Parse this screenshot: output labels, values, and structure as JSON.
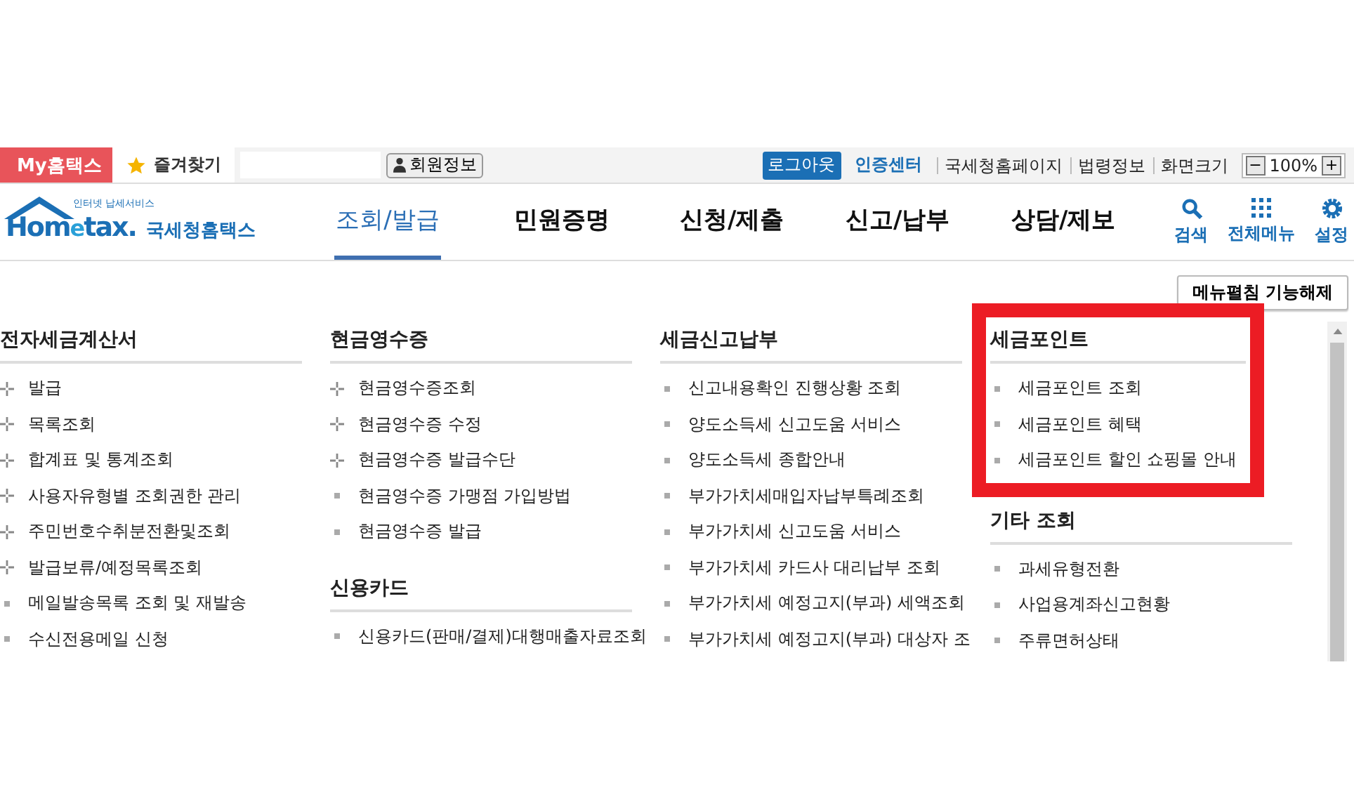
{
  "top_bar": {
    "my_hometax": "My홈택스",
    "favorites": "즐겨찾기",
    "member_info": "회원정보",
    "logout": "로그아웃",
    "cert_center": "인증센터",
    "links": [
      "국세청홈페이지",
      "법령정보"
    ],
    "screen_size": "화면크기",
    "zoom_minus": "−",
    "zoom_value": "100%",
    "zoom_plus": "+"
  },
  "header": {
    "logo": {
      "tagline": "인터넷 납세서비스",
      "name_start": "Hom",
      "name_e": "e",
      "name_end": "tax.",
      "korean": "국세청홈택스"
    },
    "tabs": [
      {
        "label": "조회/발급",
        "selected": true
      },
      {
        "label": "민원증명",
        "selected": false
      },
      {
        "label": "신청/제출",
        "selected": false
      },
      {
        "label": "신고/납부",
        "selected": false
      },
      {
        "label": "상담/제보",
        "selected": false
      }
    ],
    "tools": [
      {
        "kind": "search",
        "label": "검색"
      },
      {
        "kind": "grid",
        "label": "전체메뉴"
      },
      {
        "kind": "gear",
        "label": "설정"
      }
    ]
  },
  "menu_toggle": "메뉴펼침 기능해제",
  "columns": [
    {
      "sections": [
        {
          "title": "전자세금계산서",
          "highlighted": false,
          "items": [
            {
              "label": "발급",
              "kind": "cross"
            },
            {
              "label": "목록조회",
              "kind": "cross"
            },
            {
              "label": "합계표 및 통계조회",
              "kind": "cross"
            },
            {
              "label": "사용자유형별 조회권한 관리",
              "kind": "cross"
            },
            {
              "label": "주민번호수취분전환및조회",
              "kind": "cross"
            },
            {
              "label": "발급보류/예정목록조회",
              "kind": "cross"
            },
            {
              "label": "메일발송목록 조회 및 재발송",
              "kind": "square"
            },
            {
              "label": "수신전용메일 신청",
              "kind": "square"
            }
          ]
        }
      ]
    },
    {
      "sections": [
        {
          "title": "현금영수증",
          "highlighted": false,
          "items": [
            {
              "label": "현금영수증조회",
              "kind": "cross"
            },
            {
              "label": "현금영수증 수정",
              "kind": "cross"
            },
            {
              "label": "현금영수증 발급수단",
              "kind": "cross"
            },
            {
              "label": "현금영수증 가맹점 가입방법",
              "kind": "square"
            },
            {
              "label": "현금영수증 발급",
              "kind": "square"
            }
          ]
        },
        {
          "title": "신용카드",
          "highlighted": false,
          "items": [
            {
              "label": "신용카드(판매/결제)대행매출자료조회",
              "kind": "square"
            }
          ]
        }
      ]
    },
    {
      "sections": [
        {
          "title": "세금신고납부",
          "highlighted": false,
          "items": [
            {
              "label": "신고내용확인 진행상황 조회",
              "kind": "square"
            },
            {
              "label": "양도소득세 신고도움 서비스",
              "kind": "square"
            },
            {
              "label": "양도소득세 종합안내",
              "kind": "square"
            },
            {
              "label": "부가가치세매입자납부특례조회",
              "kind": "square"
            },
            {
              "label": "부가가치세 신고도움 서비스",
              "kind": "square"
            },
            {
              "label": "부가가치세 카드사 대리납부 조회",
              "kind": "square"
            },
            {
              "label": "부가가치세 예정고지(부과) 세액조회",
              "kind": "square"
            },
            {
              "label": "부가가치세 예정고지(부과) 대상자 조",
              "kind": "square"
            }
          ]
        }
      ]
    },
    {
      "sections": [
        {
          "title": "세금포인트",
          "highlighted": true,
          "items": [
            {
              "label": "세금포인트 조회",
              "kind": "square"
            },
            {
              "label": "세금포인트 혜택",
              "kind": "square"
            },
            {
              "label": "세금포인트 할인 쇼핑몰 안내",
              "kind": "square"
            }
          ]
        },
        {
          "title": "기타 조회",
          "highlighted": false,
          "items": [
            {
              "label": "과세유형전환",
              "kind": "square"
            },
            {
              "label": "사업용계좌신고현황",
              "kind": "square"
            },
            {
              "label": "주류면허상태",
              "kind": "square"
            }
          ]
        }
      ]
    }
  ]
}
